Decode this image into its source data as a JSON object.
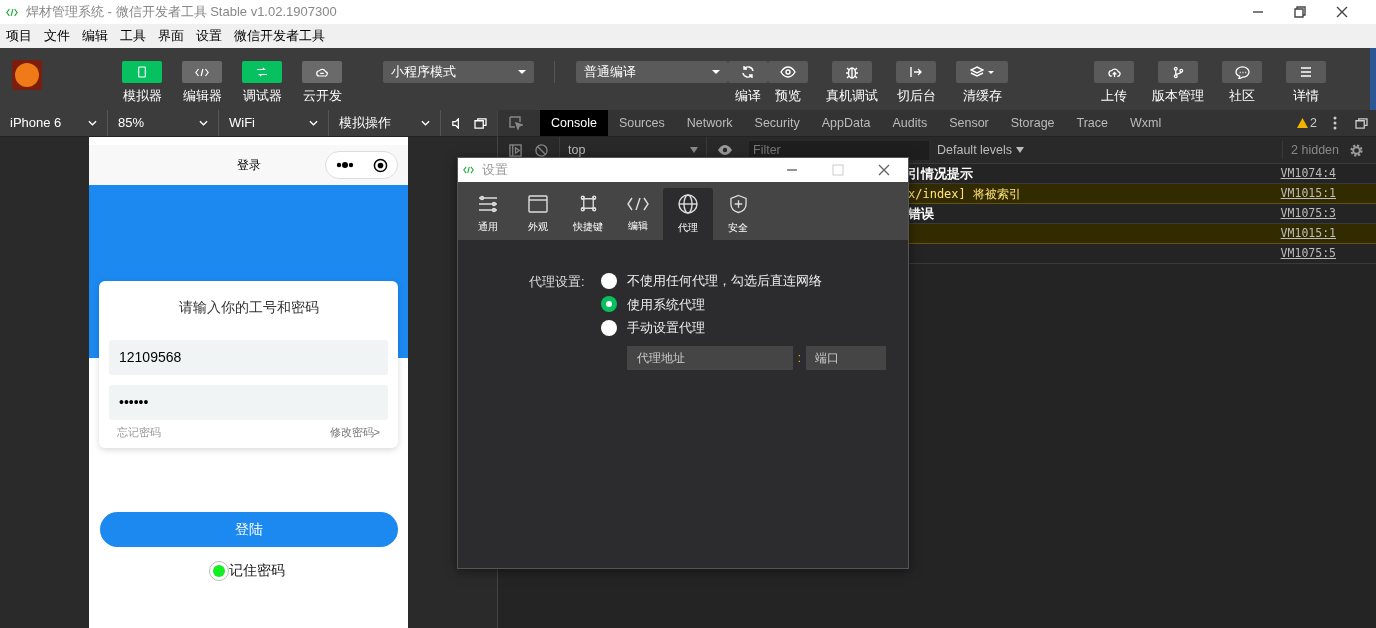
{
  "window": {
    "title": "焊材管理系统 - 微信开发者工具 Stable v1.02.1907300"
  },
  "menu": [
    "项目",
    "文件",
    "编辑",
    "工具",
    "界面",
    "设置",
    "微信开发者工具"
  ],
  "toolbar": {
    "view_buttons": [
      {
        "label": "模拟器",
        "on": true
      },
      {
        "label": "编辑器",
        "on": false
      },
      {
        "label": "调试器",
        "on": true
      },
      {
        "label": "云开发",
        "on": false
      }
    ],
    "mode_select": "小程序模式",
    "compile_select": "普通编译",
    "actions": [
      "编译",
      "预览",
      "真机调试",
      "切后台",
      "清缓存"
    ],
    "right_buttons": [
      "上传",
      "版本管理",
      "社区",
      "详情"
    ]
  },
  "simulator_bar": [
    "iPhone 6",
    "85%",
    "WiFi",
    "模拟操作"
  ],
  "devtools": {
    "tabs": [
      {
        "label": "Console",
        "selected": true
      },
      {
        "label": "Sources",
        "selected": false
      },
      {
        "label": "Network",
        "selected": false
      },
      {
        "label": "Security",
        "selected": false
      },
      {
        "label": "AppData",
        "selected": false
      },
      {
        "label": "Audits",
        "selected": false
      },
      {
        "label": "Sensor",
        "selected": false
      },
      {
        "label": "Storage",
        "selected": false
      },
      {
        "label": "Trace",
        "selected": false
      },
      {
        "label": "Wxml",
        "selected": false
      }
    ],
    "warning_count": "2",
    "context": "top",
    "filter_placeholder": "Filter",
    "levels": "Default levels",
    "hidden": "2 hidden",
    "rows": [
      {
        "kind": "info",
        "text": "引情况提示",
        "source": "VM1074:4"
      },
      {
        "kind": "warning",
        "text": "x/index] 将被索引",
        "source": "VM1015:1"
      },
      {
        "kind": "info",
        "text": "错误",
        "source": "VM1075:3"
      },
      {
        "kind": "warning",
        "source": "VM1015:1"
      },
      {
        "kind": "info",
        "source": "VM1075:5"
      }
    ]
  },
  "phone": {
    "nav_title": "登录",
    "card_title": "请输入你的工号和密码",
    "account": "12109568",
    "password": "••••••",
    "forgot": "忘记密码",
    "change": "修改密码>",
    "login": "登陆",
    "remember": {
      "label": "记住密码",
      "checked": true
    }
  },
  "dialog": {
    "title": "设置",
    "tabs": [
      {
        "label": "通用",
        "selected": false
      },
      {
        "label": "外观",
        "selected": false
      },
      {
        "label": "快捷键",
        "selected": false
      },
      {
        "label": "编辑",
        "selected": false
      },
      {
        "label": "代理",
        "selected": true
      },
      {
        "label": "安全",
        "selected": false
      }
    ],
    "proxy_label": "代理设置:",
    "options": [
      {
        "label": "不使用任何代理，勾选后直连网络",
        "selected": false
      },
      {
        "label": "使用系统代理",
        "selected": true
      },
      {
        "label": "手动设置代理",
        "selected": false
      }
    ],
    "address_placeholder": "代理地址",
    "separator": ":",
    "port_placeholder": "端口"
  }
}
